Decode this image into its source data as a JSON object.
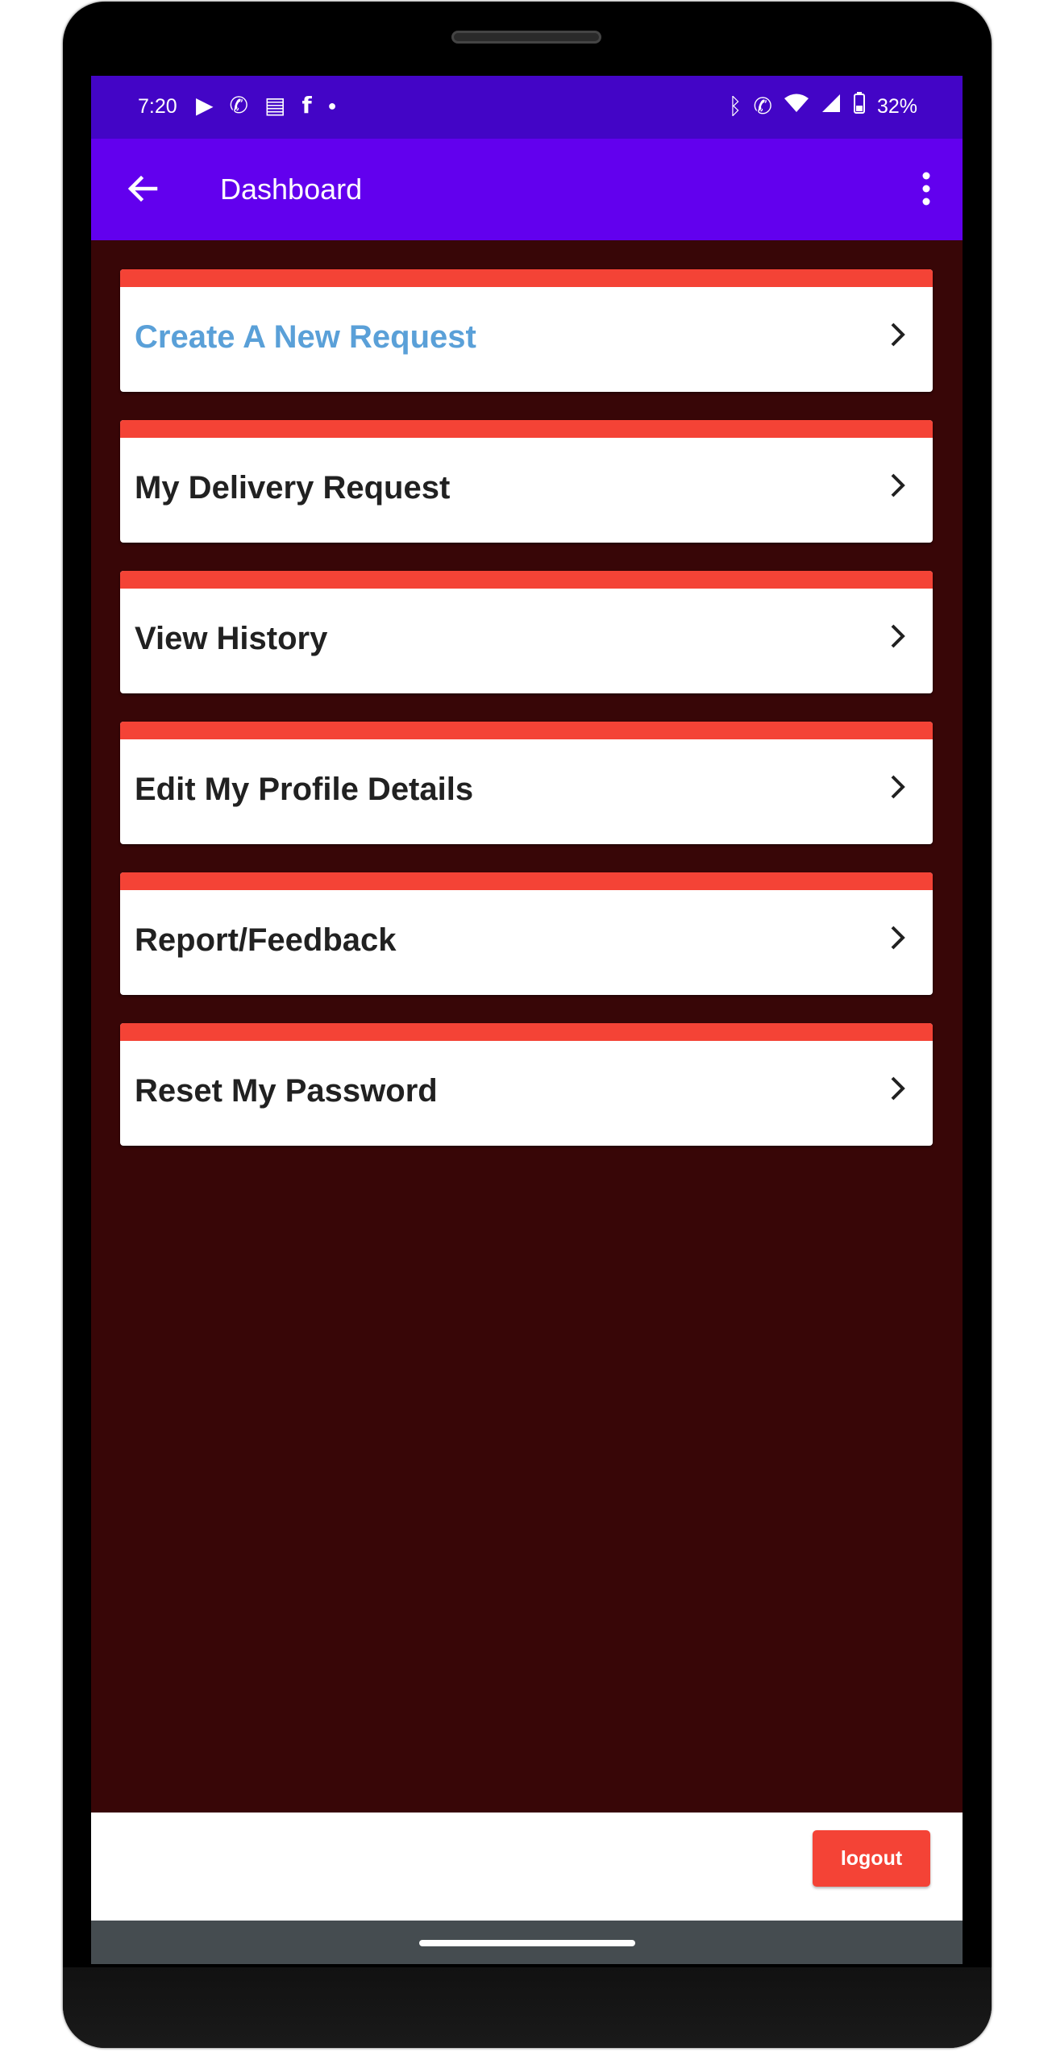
{
  "status_bar": {
    "time": "7:20",
    "battery": "32%",
    "left_icons": [
      "play-icon",
      "whatsapp-icon",
      "message-icon",
      "facebook-icon",
      "dot-icon"
    ],
    "right_icons": [
      "bluetooth-icon",
      "wifi-call-icon",
      "wifi-icon",
      "signal-icon",
      "battery-icon"
    ]
  },
  "app_bar": {
    "title": "Dashboard",
    "back_icon": "arrow-back-icon",
    "menu_icon": "more-vert-icon",
    "color": "#6200ee"
  },
  "menu": {
    "items": [
      {
        "label": "Create A New Request",
        "highlighted": true
      },
      {
        "label": "My Delivery Request",
        "highlighted": false
      },
      {
        "label": "View History",
        "highlighted": false
      },
      {
        "label": "Edit My Profile Details",
        "highlighted": false
      },
      {
        "label": "Report/Feedback",
        "highlighted": false
      },
      {
        "label": "Reset My Password",
        "highlighted": false
      }
    ],
    "stripe_color": "#f44336",
    "highlight_color": "#5aa0d8"
  },
  "footer": {
    "logout_label": "logout"
  },
  "colors": {
    "background": "#380607",
    "status_bar": "#4305c6",
    "nav_bar": "#454c50"
  }
}
